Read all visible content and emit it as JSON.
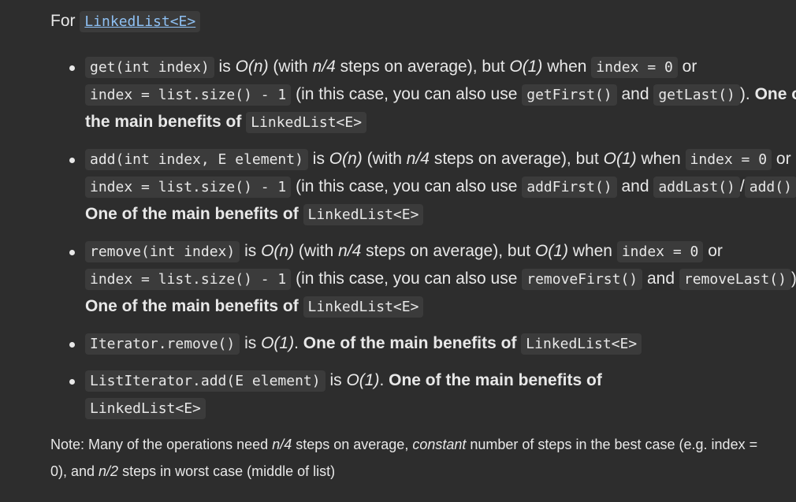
{
  "heading": {
    "prefix": "For ",
    "link": "LinkedList<E>"
  },
  "items": [
    {
      "c1": "get(int index)",
      "t1": " is ",
      "i1": "O(n)",
      "t2": " (with ",
      "i2": "n/4",
      "t3": " steps on average), but ",
      "i3": "O(1)",
      "t4": " when ",
      "c2": "index = 0",
      "t5": " or ",
      "c3": "index = list.size() - 1",
      "t6": " (in this case, you can also use ",
      "c4": "getFirst()",
      "t7": " and ",
      "c5": "getLast()",
      "t8": "). ",
      "b1": "One of the main benefits of ",
      "c6": "LinkedList<E>"
    },
    {
      "c1": "add(int index, E element)",
      "t1": " is ",
      "i1": "O(n)",
      "t2": " (with ",
      "i2": "n/4",
      "t3": " steps on average), but ",
      "i3": "O(1)",
      "t4": " when ",
      "c2": "index = 0",
      "t5": " or ",
      "c3": "index = list.size() - 1",
      "t6": " (in this case, you can also use ",
      "c4": "addFirst()",
      "t7": " and ",
      "c5": "addLast()",
      "t8": "/",
      "c7": "add()",
      "t9": "). ",
      "b1": "One of the main benefits of ",
      "c6": "LinkedList<E>"
    },
    {
      "c1": "remove(int index)",
      "t1": " is ",
      "i1": "O(n)",
      "t2": " (with ",
      "i2": "n/4",
      "t3": " steps on average), but ",
      "i3": "O(1)",
      "t4": " when ",
      "c2": "index = 0",
      "t5": " or ",
      "c3": "index = list.size() - 1",
      "t6": " (in this case, you can also use ",
      "c4": "removeFirst()",
      "t7": " and ",
      "c5": "removeLast()",
      "t8": "). ",
      "b1": "One of the main benefits of ",
      "c6": "LinkedList<E>"
    },
    {
      "c1": "Iterator.remove()",
      "t1": " is ",
      "i1": "O(1)",
      "t2": ". ",
      "b1": "One of the main benefits of ",
      "c6": "LinkedList<E>"
    },
    {
      "c1": "ListIterator.add(E element)",
      "t1": " is ",
      "i1": "O(1)",
      "t2": ". ",
      "b1": "One of the main benefits of ",
      "c6": "LinkedList<E>"
    }
  ],
  "note": {
    "t1": "Note: Many of the operations need ",
    "i1": "n/4",
    "t2": " steps on average, ",
    "i2": "constant",
    "t3": " number of steps in the best case (e.g. index = 0), and ",
    "i3": "n/2",
    "t4": " steps in worst case (middle of list)"
  }
}
